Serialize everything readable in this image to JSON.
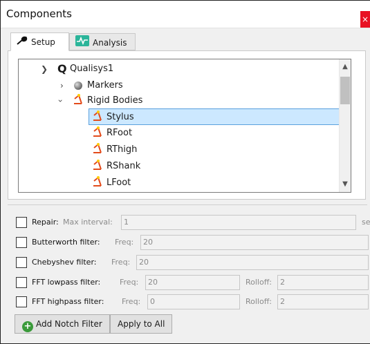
{
  "window": {
    "title": "Components",
    "close": "×"
  },
  "tabs": [
    {
      "label": "Setup",
      "icon": "wrench-icon"
    },
    {
      "label": "Analysis",
      "icon": "waveform-icon"
    }
  ],
  "tree": {
    "root": "Qualisys1",
    "markers": "Markers",
    "rigid_bodies": "Rigid Bodies",
    "bodies": [
      "Stylus",
      "RFoot",
      "RThigh",
      "RShank",
      "LFoot"
    ],
    "selected": "Stylus"
  },
  "filters": {
    "repair": {
      "label": "Repair:",
      "hint": "Max interval:",
      "value": "1",
      "unit": "sec"
    },
    "butterworth": {
      "label": "Butterworth filter:",
      "hint": "Freq:",
      "value": "20"
    },
    "chebyshev": {
      "label": "Chebyshev filter:",
      "hint": "Freq:",
      "value": "20"
    },
    "fft_lowpass": {
      "label": "FFT lowpass filter:",
      "hint": "Freq:",
      "value": "20",
      "rolloff_hint": "Rolloff:",
      "rolloff": "2"
    },
    "fft_highpass": {
      "label": "FFT highpass filter:",
      "hint": "Freq:",
      "value": "0",
      "rolloff_hint": "Rolloff:",
      "rolloff": "2"
    }
  },
  "buttons": {
    "add_notch": "Add Notch Filter",
    "apply_all": "Apply to All"
  },
  "colors": {
    "selected_bg": "#cce8ff",
    "close_red": "#e81123",
    "plus_green": "#3a9a3a"
  }
}
